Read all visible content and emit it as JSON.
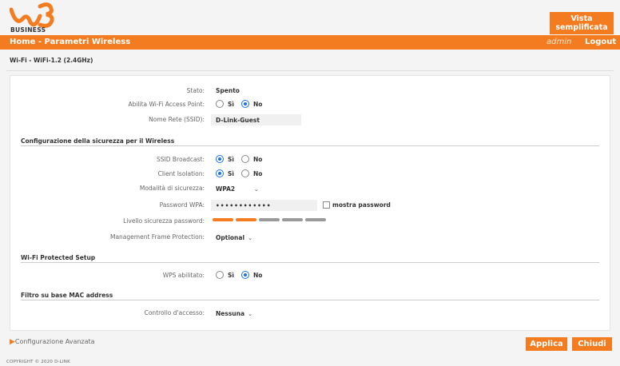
{
  "header": {
    "logo_text": "BUSINESS",
    "vista_label_line1": "Vista",
    "vista_label_line2": "semplificata"
  },
  "nav": {
    "title": "Home - Parametri Wireless",
    "user": "admin",
    "logout": "Logout"
  },
  "subtitle": "Wi-Fi - WiFi-1.2 (2.4GHz)",
  "general": {
    "stato_label": "Stato:",
    "stato_value": "Spento",
    "abilita_label": "Abilita Wi-Fi Access Point:",
    "abilita_yes": "Sì",
    "abilita_no": "No",
    "abilita_selected": "No",
    "ssid_label": "Nome Rete (SSID):",
    "ssid_value": "D-Link-Guest"
  },
  "security": {
    "title": "Configurazione della sicurezza per il Wireless",
    "broadcast_label": "SSID Broadcast:",
    "broadcast_selected": "Sì",
    "isolation_label": "Client Isolation:",
    "isolation_selected": "Sì",
    "yes": "Sì",
    "no": "No",
    "mode_label": "Modalità di sicurezza:",
    "mode_value": "WPA2",
    "password_label": "Password WPA:",
    "password_value": "••••••••••••",
    "show_password": "mostra password",
    "strength_label": "Livello sicurezza password:",
    "strength_level": 2,
    "strength_max": 5,
    "mfp_label": "Management Frame Protection:",
    "mfp_value": "Optional"
  },
  "wps": {
    "title": "Wi-Fi Protected Setup",
    "enabled_label": "WPS abilitato:",
    "yes": "Sì",
    "no": "No",
    "selected": "No"
  },
  "mac": {
    "title": "Filtro su base MAC address",
    "access_label": "Controllo d'accesso:",
    "access_value": "Nessuna"
  },
  "footer": {
    "advanced": "Configurazione Avanzata",
    "apply": "Applica",
    "close": "Chiudi",
    "copyright": "COPYRIGHT © 2020 D-LINK"
  },
  "colors": {
    "accent": "#f47c20",
    "radio_selected": "#1a73e8",
    "strength_on": "#f47c20",
    "strength_off": "#999999"
  }
}
